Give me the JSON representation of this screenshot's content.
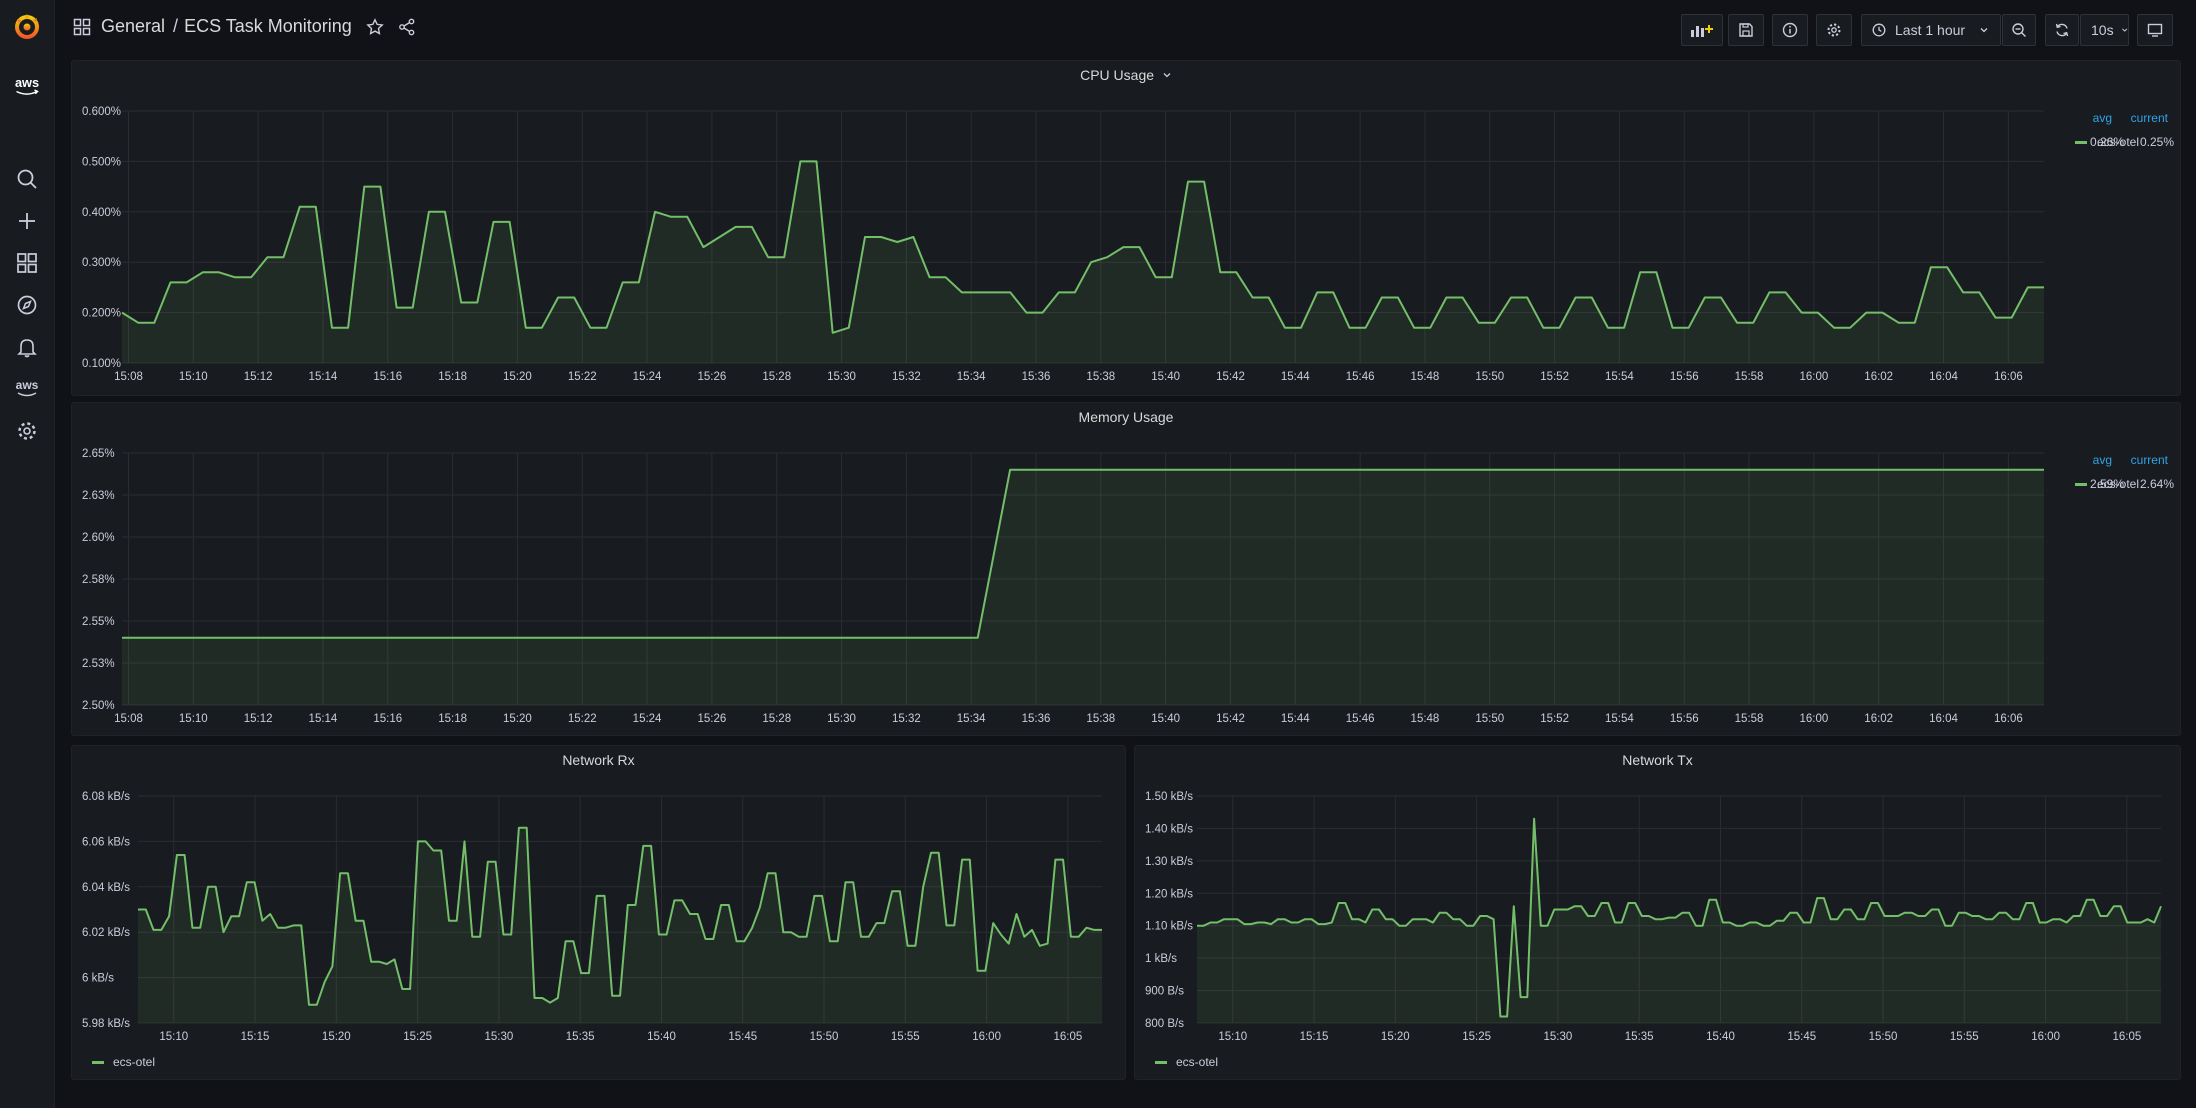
{
  "breadcrumb": {
    "folder": "General",
    "sep": "/",
    "title": "ECS Task Monitoring"
  },
  "toolbar": {
    "time_range": "Last 1 hour",
    "refresh": "10s"
  },
  "sidebar": {
    "aws_label": "aws"
  },
  "colors": {
    "series": "#73bf69",
    "accent": "#33a2e5",
    "bg": "#111217",
    "panel": "#181b1f"
  },
  "panels": {
    "cpu": {
      "title": "CPU Usage",
      "legend": {
        "headers": [
          "avg",
          "current"
        ],
        "series": "ecs-otel",
        "avg": "0.26%",
        "current": "0.25%"
      }
    },
    "mem": {
      "title": "Memory Usage",
      "legend": {
        "headers": [
          "avg",
          "current"
        ],
        "series": "ecs-otel",
        "avg": "2.59%",
        "current": "2.64%"
      }
    },
    "rx": {
      "title": "Network Rx",
      "legend": {
        "series": "ecs-otel"
      }
    },
    "tx": {
      "title": "Network Tx",
      "legend": {
        "series": "ecs-otel"
      }
    }
  },
  "chart_data": [
    {
      "type": "area",
      "title": "CPU Usage",
      "series_name": "ecs-otel",
      "x_ticks": [
        "15:08",
        "15:10",
        "15:12",
        "15:14",
        "15:16",
        "15:18",
        "15:20",
        "15:22",
        "15:24",
        "15:26",
        "15:28",
        "15:30",
        "15:32",
        "15:34",
        "15:36",
        "15:38",
        "15:40",
        "15:42",
        "15:44",
        "15:46",
        "15:48",
        "15:50",
        "15:52",
        "15:54",
        "15:56",
        "15:58",
        "16:00",
        "16:02",
        "16:04",
        "16:06"
      ],
      "y_ticks": [
        "0.100%",
        "0.200%",
        "0.300%",
        "0.400%",
        "0.500%",
        "0.600%"
      ],
      "ylim": [
        0.1,
        0.6
      ],
      "x_minutes": [
        7.8,
        67.1
      ],
      "values": [
        0.2,
        0.18,
        0.18,
        0.26,
        0.26,
        0.28,
        0.28,
        0.27,
        0.27,
        0.31,
        0.31,
        0.41,
        0.41,
        0.17,
        0.17,
        0.45,
        0.45,
        0.21,
        0.21,
        0.4,
        0.4,
        0.22,
        0.22,
        0.38,
        0.38,
        0.17,
        0.17,
        0.23,
        0.23,
        0.17,
        0.17,
        0.26,
        0.26,
        0.4,
        0.39,
        0.39,
        0.33,
        0.35,
        0.37,
        0.37,
        0.31,
        0.31,
        0.5,
        0.5,
        0.16,
        0.17,
        0.35,
        0.35,
        0.34,
        0.35,
        0.27,
        0.27,
        0.24,
        0.24,
        0.24,
        0.24,
        0.2,
        0.2,
        0.24,
        0.24,
        0.3,
        0.31,
        0.33,
        0.33,
        0.27,
        0.27,
        0.46,
        0.46,
        0.28,
        0.28,
        0.23,
        0.23,
        0.17,
        0.17,
        0.24,
        0.24,
        0.17,
        0.17,
        0.23,
        0.23,
        0.17,
        0.17,
        0.23,
        0.23,
        0.18,
        0.18,
        0.23,
        0.23,
        0.17,
        0.17,
        0.23,
        0.23,
        0.17,
        0.17,
        0.28,
        0.28,
        0.17,
        0.17,
        0.23,
        0.23,
        0.18,
        0.18,
        0.24,
        0.24,
        0.2,
        0.2,
        0.17,
        0.17,
        0.2,
        0.2,
        0.18,
        0.18,
        0.29,
        0.29,
        0.24,
        0.24,
        0.19,
        0.19,
        0.25,
        0.25
      ]
    },
    {
      "type": "area",
      "title": "Memory Usage",
      "series_name": "ecs-otel",
      "x_ticks": [
        "15:08",
        "15:10",
        "15:12",
        "15:14",
        "15:16",
        "15:18",
        "15:20",
        "15:22",
        "15:24",
        "15:26",
        "15:28",
        "15:30",
        "15:32",
        "15:34",
        "15:36",
        "15:38",
        "15:40",
        "15:42",
        "15:44",
        "15:46",
        "15:48",
        "15:50",
        "15:52",
        "15:54",
        "15:56",
        "15:58",
        "16:00",
        "16:02",
        "16:04",
        "16:06"
      ],
      "y_ticks": [
        "2.50%",
        "2.53%",
        "2.55%",
        "2.58%",
        "2.60%",
        "2.63%",
        "2.65%"
      ],
      "ylim": [
        2.5,
        2.65
      ],
      "x_minutes": [
        7.8,
        67.1
      ],
      "points": [
        [
          7.8,
          2.54
        ],
        [
          34.2,
          2.54
        ],
        [
          35.2,
          2.64
        ],
        [
          67.1,
          2.64
        ]
      ]
    },
    {
      "type": "area",
      "title": "Network Rx",
      "series_name": "ecs-otel",
      "x_ticks": [
        "15:10",
        "15:15",
        "15:20",
        "15:25",
        "15:30",
        "15:35",
        "15:40",
        "15:45",
        "15:50",
        "15:55",
        "16:00",
        "16:05"
      ],
      "y_ticks": [
        "5.98 kB/s",
        "6 kB/s",
        "6.02 kB/s",
        "6.04 kB/s",
        "6.06 kB/s",
        "6.08 kB/s"
      ],
      "ylim": [
        5.98,
        6.08
      ],
      "x_minutes": [
        7.8,
        67.1
      ],
      "values": [
        6.03,
        6.03,
        6.021,
        6.021,
        6.027,
        6.054,
        6.054,
        6.022,
        6.022,
        6.04,
        6.04,
        6.02,
        6.027,
        6.027,
        6.042,
        6.042,
        6.025,
        6.028,
        6.022,
        6.022,
        6.023,
        6.023,
        5.988,
        5.988,
        5.998,
        6.005,
        6.046,
        6.046,
        6.025,
        6.025,
        6.007,
        6.007,
        6.006,
        6.008,
        5.995,
        5.995,
        6.06,
        6.06,
        6.056,
        6.056,
        6.025,
        6.025,
        6.06,
        6.018,
        6.018,
        6.051,
        6.051,
        6.019,
        6.019,
        6.066,
        6.066,
        5.991,
        5.991,
        5.989,
        5.991,
        6.016,
        6.016,
        6.002,
        6.002,
        6.036,
        6.036,
        5.992,
        5.992,
        6.032,
        6.032,
        6.058,
        6.058,
        6.019,
        6.019,
        6.034,
        6.034,
        6.028,
        6.028,
        6.017,
        6.017,
        6.032,
        6.032,
        6.016,
        6.016,
        6.022,
        6.031,
        6.046,
        6.046,
        6.02,
        6.02,
        6.018,
        6.018,
        6.036,
        6.036,
        6.016,
        6.016,
        6.042,
        6.042,
        6.018,
        6.018,
        6.024,
        6.024,
        6.038,
        6.038,
        6.014,
        6.014,
        6.04,
        6.055,
        6.055,
        6.023,
        6.023,
        6.052,
        6.052,
        6.003,
        6.003,
        6.024,
        6.019,
        6.015,
        6.028,
        6.018,
        6.021,
        6.014,
        6.015,
        6.052,
        6.052,
        6.018,
        6.018,
        6.022,
        6.021,
        6.021
      ]
    },
    {
      "type": "area",
      "title": "Network Tx",
      "series_name": "ecs-otel",
      "x_ticks": [
        "15:10",
        "15:15",
        "15:20",
        "15:25",
        "15:30",
        "15:35",
        "15:40",
        "15:45",
        "15:50",
        "15:55",
        "16:00",
        "16:05"
      ],
      "y_ticks": [
        "800 B/s",
        "900 B/s",
        "1 kB/s",
        "1.10 kB/s",
        "1.20 kB/s",
        "1.30 kB/s",
        "1.40 kB/s",
        "1.50 kB/s"
      ],
      "ylim": [
        800,
        1500
      ],
      "x_minutes": [
        7.8,
        67.1
      ],
      "values": [
        1100,
        1100,
        1110,
        1110,
        1120,
        1120,
        1120,
        1105,
        1105,
        1110,
        1110,
        1105,
        1120,
        1120,
        1110,
        1110,
        1120,
        1120,
        1105,
        1105,
        1110,
        1170,
        1170,
        1120,
        1120,
        1110,
        1150,
        1150,
        1120,
        1120,
        1100,
        1100,
        1120,
        1120,
        1120,
        1110,
        1140,
        1140,
        1120,
        1120,
        1100,
        1100,
        1130,
        1130,
        1120,
        820,
        820,
        1160,
        880,
        880,
        1430,
        1100,
        1100,
        1150,
        1150,
        1150,
        1160,
        1160,
        1130,
        1130,
        1170,
        1170,
        1110,
        1110,
        1170,
        1170,
        1130,
        1130,
        1120,
        1120,
        1125,
        1125,
        1140,
        1140,
        1100,
        1100,
        1180,
        1180,
        1110,
        1110,
        1100,
        1100,
        1110,
        1110,
        1100,
        1100,
        1115,
        1115,
        1140,
        1140,
        1110,
        1110,
        1185,
        1185,
        1120,
        1120,
        1150,
        1150,
        1120,
        1120,
        1170,
        1170,
        1130,
        1130,
        1130,
        1140,
        1140,
        1130,
        1130,
        1150,
        1150,
        1100,
        1100,
        1140,
        1140,
        1130,
        1130,
        1120,
        1120,
        1140,
        1140,
        1120,
        1120,
        1170,
        1170,
        1110,
        1110,
        1120,
        1120,
        1110,
        1130,
        1130,
        1180,
        1180,
        1130,
        1130,
        1160,
        1160,
        1110,
        1110,
        1110,
        1120,
        1110,
        1160
      ]
    }
  ]
}
